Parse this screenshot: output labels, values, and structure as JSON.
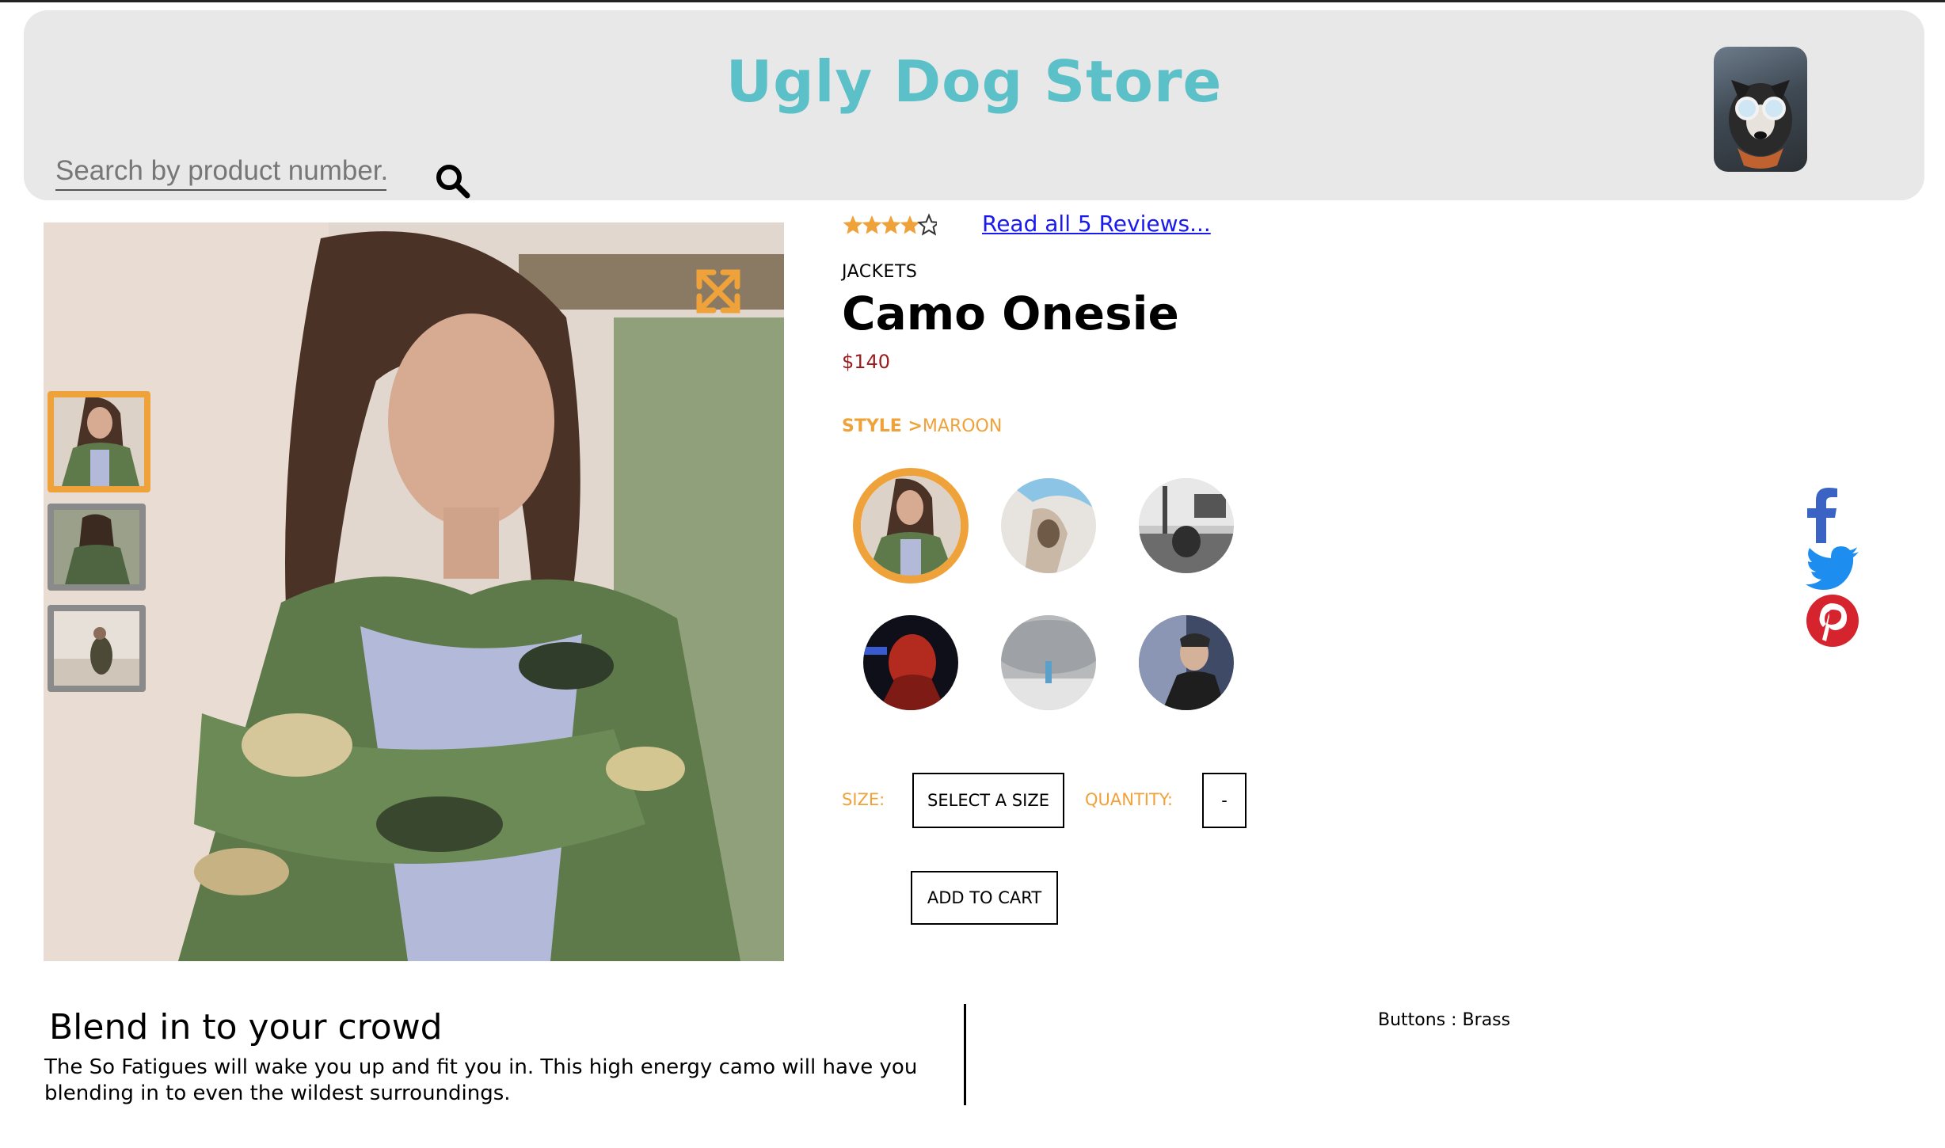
{
  "header": {
    "title": "Ugly Dog Store",
    "search_placeholder": "Search by product number....",
    "search_icon": "search-icon",
    "avatar_icon": "dog-avatar"
  },
  "gallery": {
    "expand_icon": "expand-arrows-icon",
    "thumbnails": [
      "thumbnail-1",
      "thumbnail-2",
      "thumbnail-3"
    ],
    "active_thumbnail": 0
  },
  "rating": {
    "stars": 4,
    "max_stars": 5,
    "reviews_link": "Read all 5 Reviews..."
  },
  "product": {
    "category": "JACKETS",
    "name": "Camo Onesie",
    "price": "$140"
  },
  "style": {
    "label": "STYLE >",
    "selected": "MAROON",
    "swatch_count": 6,
    "active_swatch": 0
  },
  "purchase": {
    "size_label": "SIZE:",
    "size_select": "SELECT A SIZE",
    "quantity_label": "QUANTITY:",
    "quantity_value": "-",
    "add_to_cart": "ADD TO CART"
  },
  "description": {
    "heading": "Blend in to your crowd",
    "body": "The So Fatigues will wake you up and fit you in. This high energy camo will have you blending in to even the wildest surroundings."
  },
  "features": {
    "item": "Buttons : Brass"
  },
  "social": [
    "facebook-icon",
    "twitter-icon",
    "pinterest-icon"
  ],
  "colors": {
    "accent": "#f0a23a",
    "title": "#5bc0c8",
    "price": "#9b1c1c",
    "link": "#1a1aee",
    "facebook": "#3b63c4",
    "twitter": "#1d8ef0",
    "pinterest": "#d6242e"
  }
}
